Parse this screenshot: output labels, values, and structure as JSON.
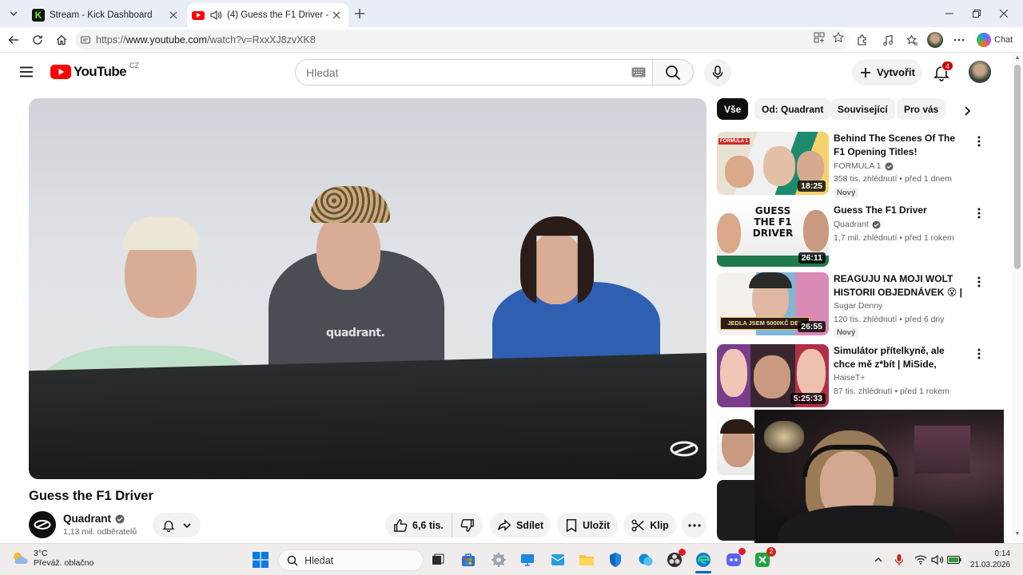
{
  "browser": {
    "tabs": [
      {
        "title": "Stream - Kick Dashboard",
        "active": false,
        "favicon_color": "#53fc18"
      },
      {
        "title": "(4) Guess the F1 Driver - YouTube",
        "active": true,
        "favicon_color": "#ff0000",
        "audio": true
      }
    ],
    "address": {
      "prefix": "https://",
      "host": "www.youtube.com",
      "path": "/watch?v=RxxXJ8zvXK8"
    },
    "chat_label": "Chat"
  },
  "youtube": {
    "logo_text": "YouTube",
    "region": "CZ",
    "search_placeholder": "Hledat",
    "create_label": "Vytvořit",
    "notification_count": "4",
    "accent": "#ff0000"
  },
  "video": {
    "title": "Guess the F1 Driver",
    "channel": "Quadrant",
    "subscribers": "1,13 mil. odběratelů",
    "likes": "6,6 tis.",
    "share_label": "Sdílet",
    "save_label": "Uložit",
    "clip_label": "Klip"
  },
  "chips": [
    {
      "label": "Vše",
      "active": true
    },
    {
      "label": "Od: Quadrant",
      "active": false
    },
    {
      "label": "Související",
      "active": false
    },
    {
      "label": "Pro vás",
      "active": false
    }
  ],
  "related": [
    {
      "title": "Behind The Scenes Of The F1 Opening Titles!",
      "channel": "FORMULA 1",
      "verified": true,
      "meta": "358 tis. zhlédnutí • před 1 dnem",
      "badge": "Nový",
      "duration": "18:25"
    },
    {
      "title": "Guess The F1 Driver",
      "channel": "Quadrant",
      "verified": true,
      "meta": "1,7 mil. zhlédnutí • před 1 rokem",
      "badge": "",
      "duration": "26:11"
    },
    {
      "title": "REAGUJU NA MOJI WOLT HISTORII OBJEDNÁVEK 😵 | ...",
      "channel": "Sugar Denny",
      "verified": false,
      "meta": "120 tis. zhlédnutí • před 6 dny",
      "badge": "Nový",
      "duration": "26:55"
    },
    {
      "title": "Simulátor přítelkyně, ale chce mě z*bít | MiSide, všechny ...",
      "channel": "HaiseT+",
      "verified": false,
      "meta": "87 tis. zhlédnutí • před 1 rokem",
      "badge": "",
      "duration": "5:25:33"
    }
  ],
  "thumb_text": {
    "t2": "GUESS THE F1 DRIVER",
    "t3": "JEDLA JSEM 5000KČ DEF",
    "t1": "FORMULA 1"
  },
  "taskbar": {
    "temperature": "3°C",
    "weather": "Převáž. oblačno",
    "search_placeholder": "Hledat",
    "time": "0:14",
    "date": "21.03.2026",
    "whatsapp_badge": "2"
  }
}
